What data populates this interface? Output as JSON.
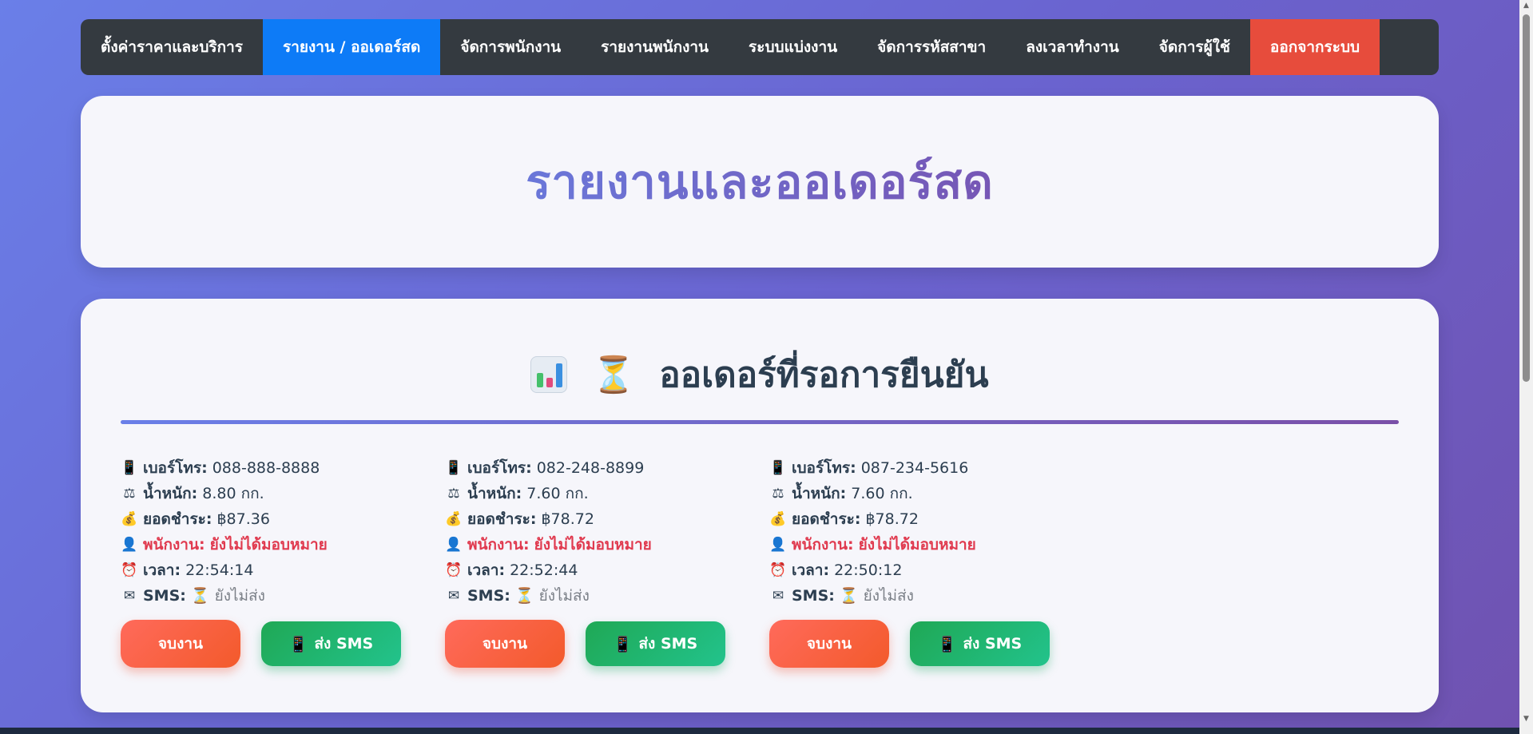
{
  "nav": {
    "items": [
      {
        "label": "ตั้งค่าราคาและบริการ"
      },
      {
        "label": "รายงาน / ออเดอร์สด"
      },
      {
        "label": "จัดการพนักงาน"
      },
      {
        "label": "รายงานพนักงาน"
      },
      {
        "label": "ระบบแบ่งงาน"
      },
      {
        "label": "จัดการรหัสสาขา"
      },
      {
        "label": "ลงเวลาทำงาน"
      },
      {
        "label": "จัดการผู้ใช้"
      }
    ],
    "logout_label": "ออกจากระบบ",
    "active_color": "#0d7bf7",
    "logout_color": "#e74c3c"
  },
  "hero": {
    "title": "รายงานและออเดอร์สด"
  },
  "pending": {
    "title": "ออเดอร์ที่รอการยืนยัน",
    "hourglass": "⏳"
  },
  "labels": {
    "phone": "เบอร์โทร:",
    "weight": "น้ำหนัก:",
    "total": "ยอดชำระ:",
    "staff": "พนักงาน:",
    "time": "เวลา:",
    "sms": "SMS:",
    "finish_btn": "จบงาน",
    "sms_btn": "ส่ง SMS"
  },
  "orders": [
    {
      "phone": "088-888-8888",
      "weight": "8.80 กก.",
      "total": "฿87.36",
      "staff": "ยังไม่ได้มอบหมาย",
      "time": "22:54:14",
      "sms_status": "⏳ ยังไม่ส่ง"
    },
    {
      "phone": "082-248-8899",
      "weight": "7.60 กก.",
      "total": "฿78.72",
      "staff": "ยังไม่ได้มอบหมาย",
      "time": "22:52:44",
      "sms_status": "⏳ ยังไม่ส่ง"
    },
    {
      "phone": "087-234-5616",
      "weight": "7.60 กก.",
      "total": "฿78.72",
      "staff": "ยังไม่ได้มอบหมาย",
      "time": "22:50:12",
      "sms_status": "⏳ ยังไม่ส่ง"
    }
  ],
  "icons": {
    "phone": "phone-icon",
    "weight": "scale-icon",
    "total": "money-bag-icon",
    "staff": "person-icon",
    "time": "alarm-clock-icon",
    "sms": "envelope-icon"
  }
}
